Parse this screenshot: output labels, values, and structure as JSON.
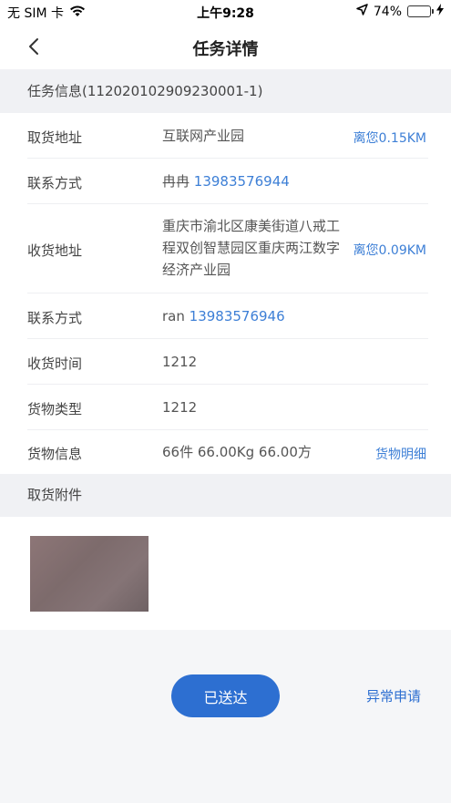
{
  "status_bar": {
    "carrier": "无 SIM 卡",
    "time": "上午9:28",
    "battery_text": "74%",
    "battery_level": 0.74
  },
  "nav": {
    "title": "任务详情"
  },
  "task_info": {
    "header": "任务信息(112020102909230001-1)",
    "rows": [
      {
        "label": "取货地址",
        "value": "互联网产业园",
        "action": "离您0.15KM"
      },
      {
        "label": "联系方式",
        "name": "冉冉",
        "phone": "13983576944"
      },
      {
        "label": "收货地址",
        "value": "重庆市渝北区康美街道八戒工程双创智慧园区重庆两江数字经济产业园",
        "action": "离您0.09KM"
      },
      {
        "label": "联系方式",
        "name": "ran",
        "phone": "13983576946"
      },
      {
        "label": "收货时间",
        "value": "1212"
      },
      {
        "label": "货物类型",
        "value": "1212"
      },
      {
        "label": "货物信息",
        "value": "66件 66.00Kg 66.00方",
        "action": "货物明细"
      }
    ]
  },
  "attachment": {
    "header": "取货附件"
  },
  "actions": {
    "primary": "已送达",
    "secondary": "异常申请"
  },
  "colors": {
    "accent": "#2d6fd1",
    "link": "#3d7fd6",
    "battery": "#4cd964"
  }
}
